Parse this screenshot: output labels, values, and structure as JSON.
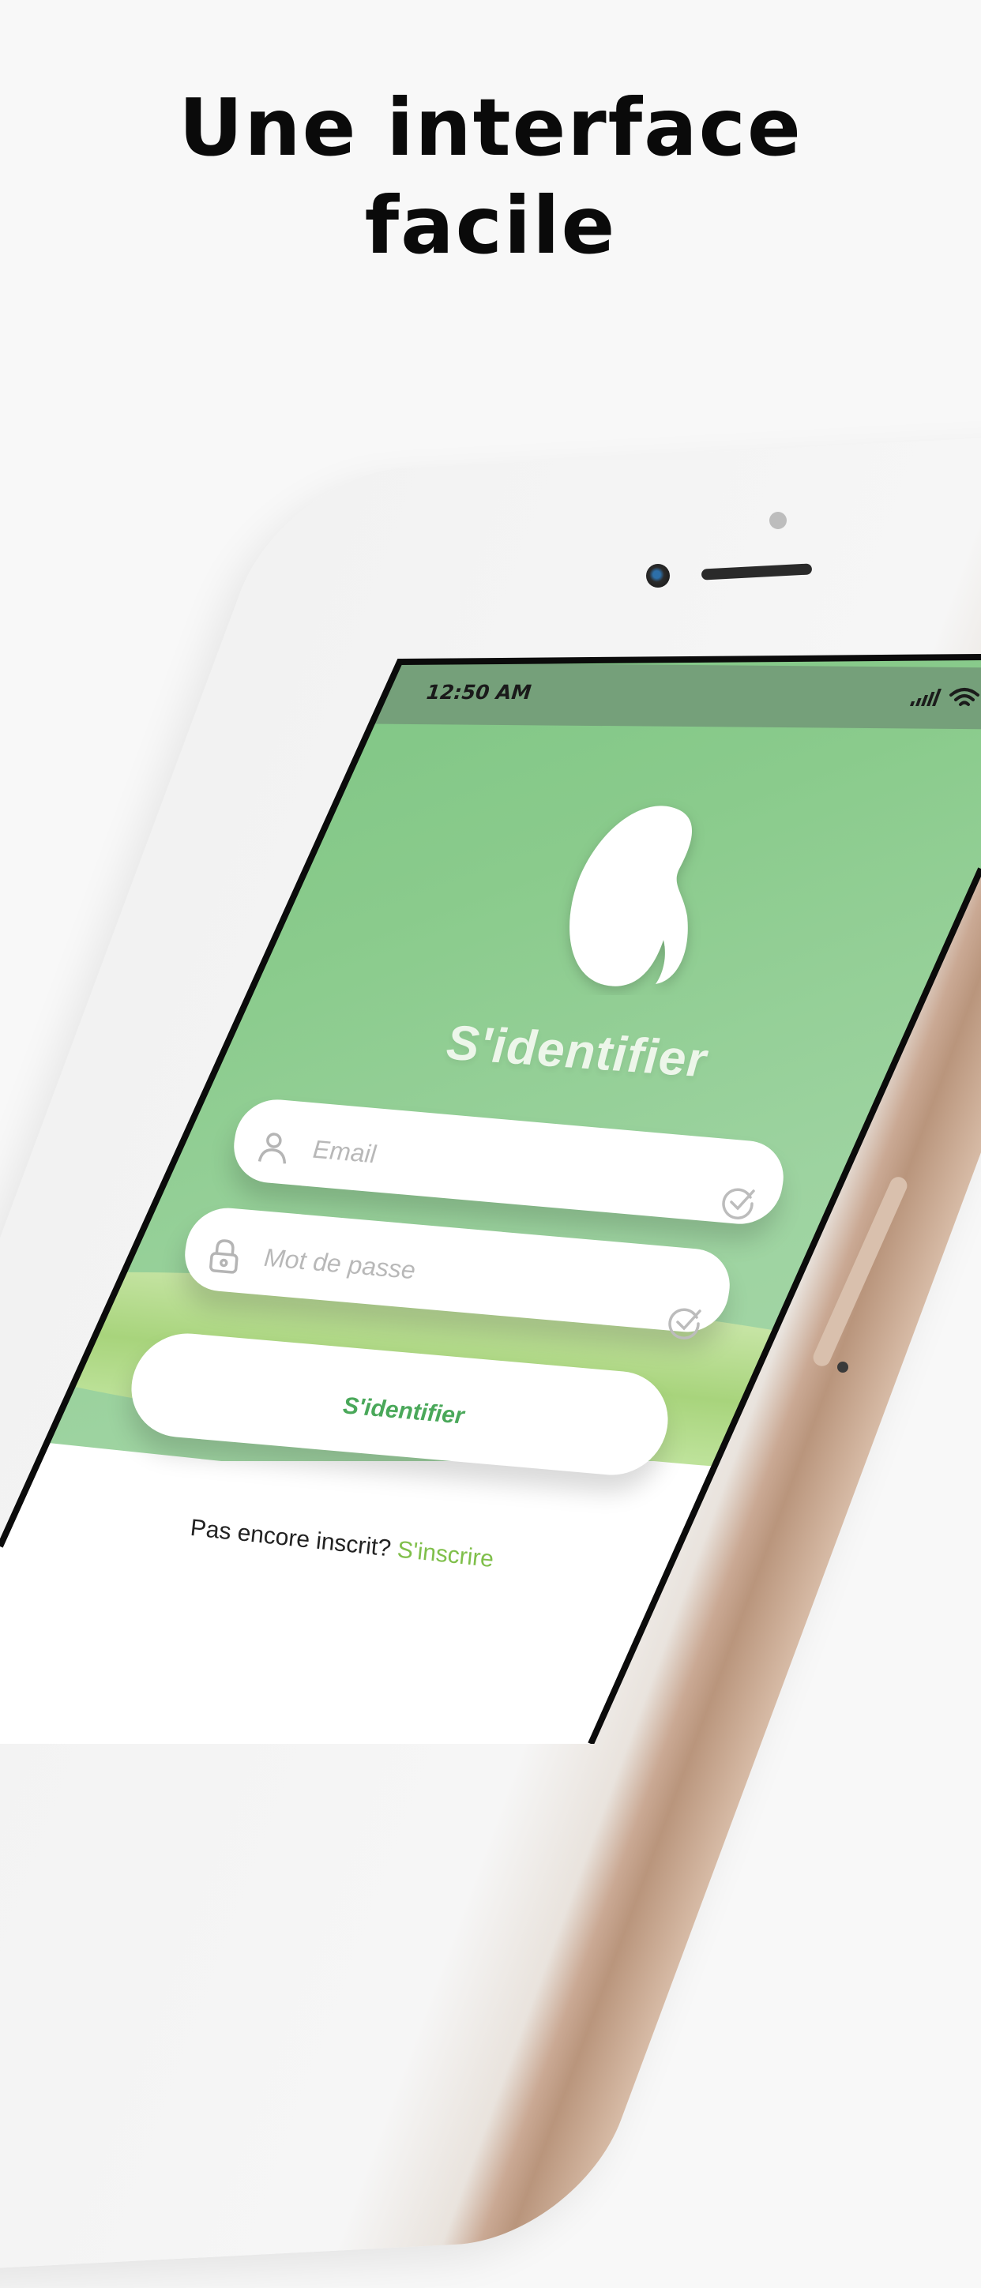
{
  "promo": {
    "headline_line1": "Une interface",
    "headline_line2": "facile"
  },
  "status_bar": {
    "time": "12:50 AM",
    "icons": [
      "signal-icon",
      "wifi-icon"
    ]
  },
  "login": {
    "title": "S'identifier",
    "logo_icon": "kidney-logo-icon",
    "email_placeholder": "Email",
    "password_placeholder": "Mot de passe",
    "submit_label": "S'identifier",
    "signup_prompt": "Pas encore inscrit?",
    "signup_link": "S'inscrire"
  },
  "colors": {
    "green_primary": "#7cc483",
    "status_bar": "#75a07a",
    "accent_lime": "#a8d47c",
    "link_green": "#7fbf4a",
    "button_text": "#4aa85a"
  }
}
